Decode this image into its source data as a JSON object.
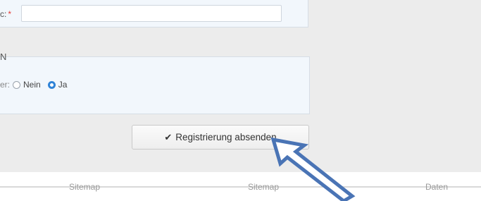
{
  "form": {
    "field_label_fragment": "c:",
    "required_mark": "*",
    "field_value": "",
    "section_heading_fragment": "N",
    "radio_label_fragment": "er:",
    "radio_options": [
      "Nein",
      "Ja"
    ],
    "radio_selected": "Ja"
  },
  "submit": {
    "label": "Registrierung absenden",
    "icon": "check-icon"
  },
  "footer": {
    "cut_labels": [
      "Sitemap",
      "Sitemap",
      "Daten"
    ]
  },
  "annotation": {
    "icon": "pointer-arrow",
    "color": "#4a74b5"
  }
}
